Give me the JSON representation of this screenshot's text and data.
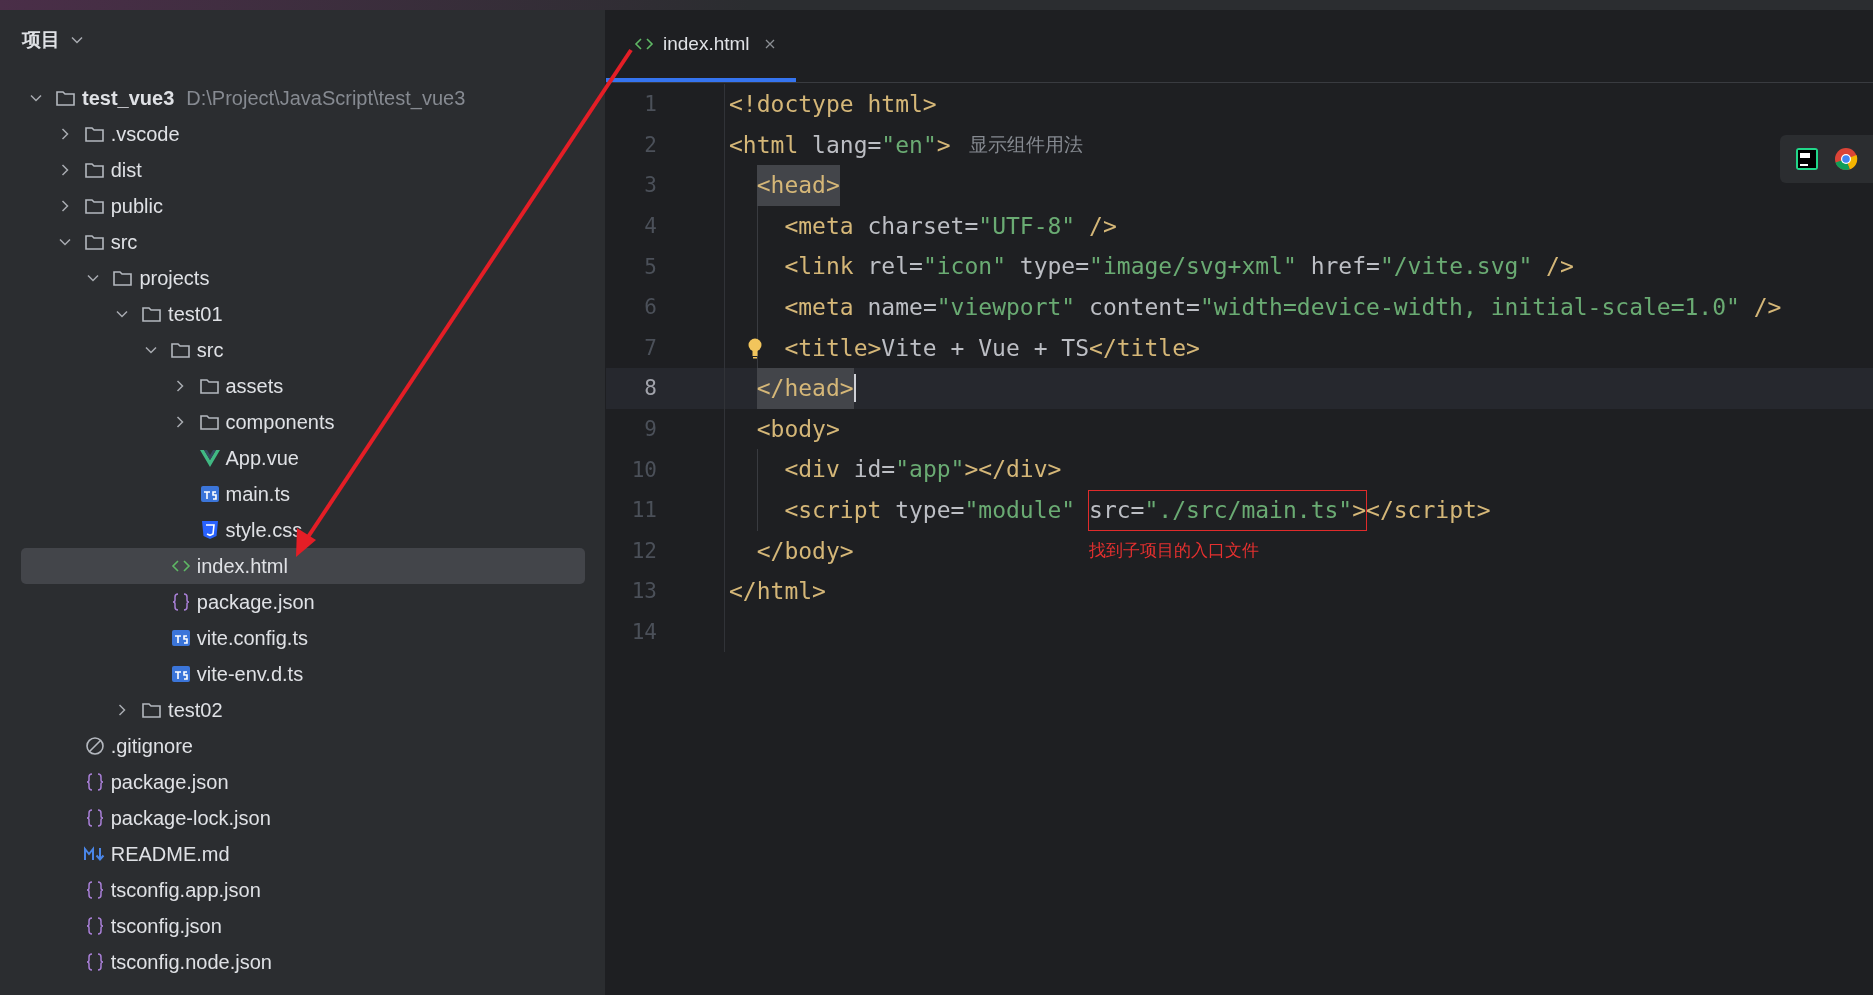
{
  "header": {
    "title": "项目"
  },
  "tree": [
    {
      "name": "test_vue3",
      "path": "D:\\Project\\JavaScript\\test_vue3",
      "kind": "project",
      "expanded": true,
      "selected": false,
      "children": [
        {
          "name": ".vscode",
          "kind": "folder",
          "expanded": false,
          "selected": false
        },
        {
          "name": "dist",
          "kind": "folder",
          "expanded": false,
          "selected": false
        },
        {
          "name": "public",
          "kind": "folder",
          "expanded": false,
          "selected": false
        },
        {
          "name": "src",
          "kind": "folder",
          "expanded": true,
          "selected": false,
          "children": [
            {
              "name": "projects",
              "kind": "folder",
              "expanded": true,
              "selected": false,
              "children": [
                {
                  "name": "test01",
                  "kind": "folder",
                  "expanded": true,
                  "selected": false,
                  "children": [
                    {
                      "name": "src",
                      "kind": "folder",
                      "expanded": true,
                      "selected": false,
                      "children": [
                        {
                          "name": "assets",
                          "kind": "folder",
                          "expanded": false,
                          "selected": false
                        },
                        {
                          "name": "components",
                          "kind": "folder",
                          "expanded": false,
                          "selected": false
                        },
                        {
                          "name": "App.vue",
                          "kind": "vue",
                          "selected": false
                        },
                        {
                          "name": "main.ts",
                          "kind": "ts",
                          "selected": false
                        },
                        {
                          "name": "style.css",
                          "kind": "css",
                          "selected": false
                        }
                      ]
                    },
                    {
                      "name": "index.html",
                      "kind": "html",
                      "selected": true
                    },
                    {
                      "name": "package.json",
                      "kind": "json",
                      "selected": false
                    },
                    {
                      "name": "vite.config.ts",
                      "kind": "ts",
                      "selected": false
                    },
                    {
                      "name": "vite-env.d.ts",
                      "kind": "ts",
                      "selected": false
                    }
                  ]
                },
                {
                  "name": "test02",
                  "kind": "folder",
                  "expanded": false,
                  "selected": false
                }
              ]
            }
          ]
        },
        {
          "name": ".gitignore",
          "kind": "gitignore",
          "selected": false
        },
        {
          "name": "package.json",
          "kind": "json",
          "selected": false
        },
        {
          "name": "package-lock.json",
          "kind": "json",
          "selected": false
        },
        {
          "name": "README.md",
          "kind": "md",
          "selected": false
        },
        {
          "name": "tsconfig.app.json",
          "kind": "json",
          "selected": false
        },
        {
          "name": "tsconfig.json",
          "kind": "json",
          "selected": false
        },
        {
          "name": "tsconfig.node.json",
          "kind": "json",
          "selected": false
        }
      ]
    }
  ],
  "tabs": [
    {
      "label": "index.html",
      "kind": "html",
      "selected": true
    }
  ],
  "editor": {
    "lines": [
      {
        "number": "1",
        "current": false,
        "bulb": false,
        "tokens": [
          {
            "kind": "tag",
            "text": "<!doctype html>"
          }
        ]
      },
      {
        "number": "2",
        "current": false,
        "bulb": false,
        "tokens": [
          {
            "kind": "tag",
            "text": "<html"
          },
          {
            "kind": "attr",
            "text": " lang"
          },
          {
            "kind": "plain",
            "text": "="
          },
          {
            "kind": "str",
            "text": "\"en\""
          },
          {
            "kind": "tag",
            "text": ">"
          }
        ],
        "hint": "显示组件用法"
      },
      {
        "number": "3",
        "current": false,
        "bulb": false,
        "tokens": [
          {
            "kind": "matched",
            "text": "  <head>"
          }
        ]
      },
      {
        "number": "4",
        "current": false,
        "bulb": false,
        "tokens": [
          {
            "kind": "tag",
            "text": "    <meta"
          },
          {
            "kind": "attr",
            "text": " charset"
          },
          {
            "kind": "plain",
            "text": "="
          },
          {
            "kind": "str",
            "text": "\"UTF-8\""
          },
          {
            "kind": "tag",
            "text": " />"
          }
        ]
      },
      {
        "number": "5",
        "current": false,
        "bulb": false,
        "tokens": [
          {
            "kind": "tag",
            "text": "    <link"
          },
          {
            "kind": "attr",
            "text": " rel"
          },
          {
            "kind": "plain",
            "text": "="
          },
          {
            "kind": "str",
            "text": "\"icon\""
          },
          {
            "kind": "attr",
            "text": " type"
          },
          {
            "kind": "plain",
            "text": "="
          },
          {
            "kind": "str",
            "text": "\"image/svg+xml\""
          },
          {
            "kind": "attr",
            "text": " href"
          },
          {
            "kind": "plain",
            "text": "="
          },
          {
            "kind": "str",
            "text": "\"/vite.svg\""
          },
          {
            "kind": "tag",
            "text": " />"
          }
        ]
      },
      {
        "number": "6",
        "current": false,
        "bulb": false,
        "tokens": [
          {
            "kind": "tag",
            "text": "    <meta"
          },
          {
            "kind": "attr",
            "text": " name"
          },
          {
            "kind": "plain",
            "text": "="
          },
          {
            "kind": "str",
            "text": "\"viewport\""
          },
          {
            "kind": "attr",
            "text": " content"
          },
          {
            "kind": "plain",
            "text": "="
          },
          {
            "kind": "str",
            "text": "\"width=device-width, initial-scale=1.0\""
          },
          {
            "kind": "tag",
            "text": " />"
          }
        ]
      },
      {
        "number": "7",
        "current": false,
        "bulb": true,
        "tokens": [
          {
            "kind": "tag",
            "text": "    <title>"
          },
          {
            "kind": "plain",
            "text": "Vite + Vue + TS"
          },
          {
            "kind": "tag",
            "text": "</title>"
          }
        ]
      },
      {
        "number": "8",
        "current": true,
        "bulb": false,
        "tokens": [
          {
            "kind": "matched",
            "text": "  </head>"
          }
        ]
      },
      {
        "number": "9",
        "current": false,
        "bulb": false,
        "tokens": [
          {
            "kind": "tag",
            "text": "  <body>"
          }
        ]
      },
      {
        "number": "10",
        "current": false,
        "bulb": false,
        "tokens": [
          {
            "kind": "tag",
            "text": "    <div"
          },
          {
            "kind": "attr",
            "text": " id"
          },
          {
            "kind": "plain",
            "text": "="
          },
          {
            "kind": "str",
            "text": "\"app\""
          },
          {
            "kind": "tag",
            "text": "></div>"
          }
        ]
      },
      {
        "number": "11",
        "current": false,
        "bulb": false,
        "tokens": [
          {
            "kind": "tag",
            "text": "    <script"
          },
          {
            "kind": "attr",
            "text": " type"
          },
          {
            "kind": "plain",
            "text": "="
          },
          {
            "kind": "str",
            "text": "\"module\" "
          },
          {
            "kind": "box",
            "tokens": [
              {
                "kind": "attr",
                "text": "src"
              },
              {
                "kind": "plain",
                "text": "="
              },
              {
                "kind": "str",
                "text": "\"./src/main.ts\""
              },
              {
                "kind": "tag",
                "text": ">"
              }
            ]
          },
          {
            "kind": "tag",
            "text": "</script>"
          }
        ]
      },
      {
        "number": "12",
        "current": false,
        "bulb": false,
        "tokens": [
          {
            "kind": "tag",
            "text": "  </body>"
          }
        ],
        "note": "找到子项目的入口文件"
      },
      {
        "number": "13",
        "current": false,
        "bulb": false,
        "tokens": [
          {
            "kind": "tag",
            "text": "</html>"
          }
        ]
      },
      {
        "number": "14",
        "current": false,
        "bulb": false
      }
    ]
  }
}
